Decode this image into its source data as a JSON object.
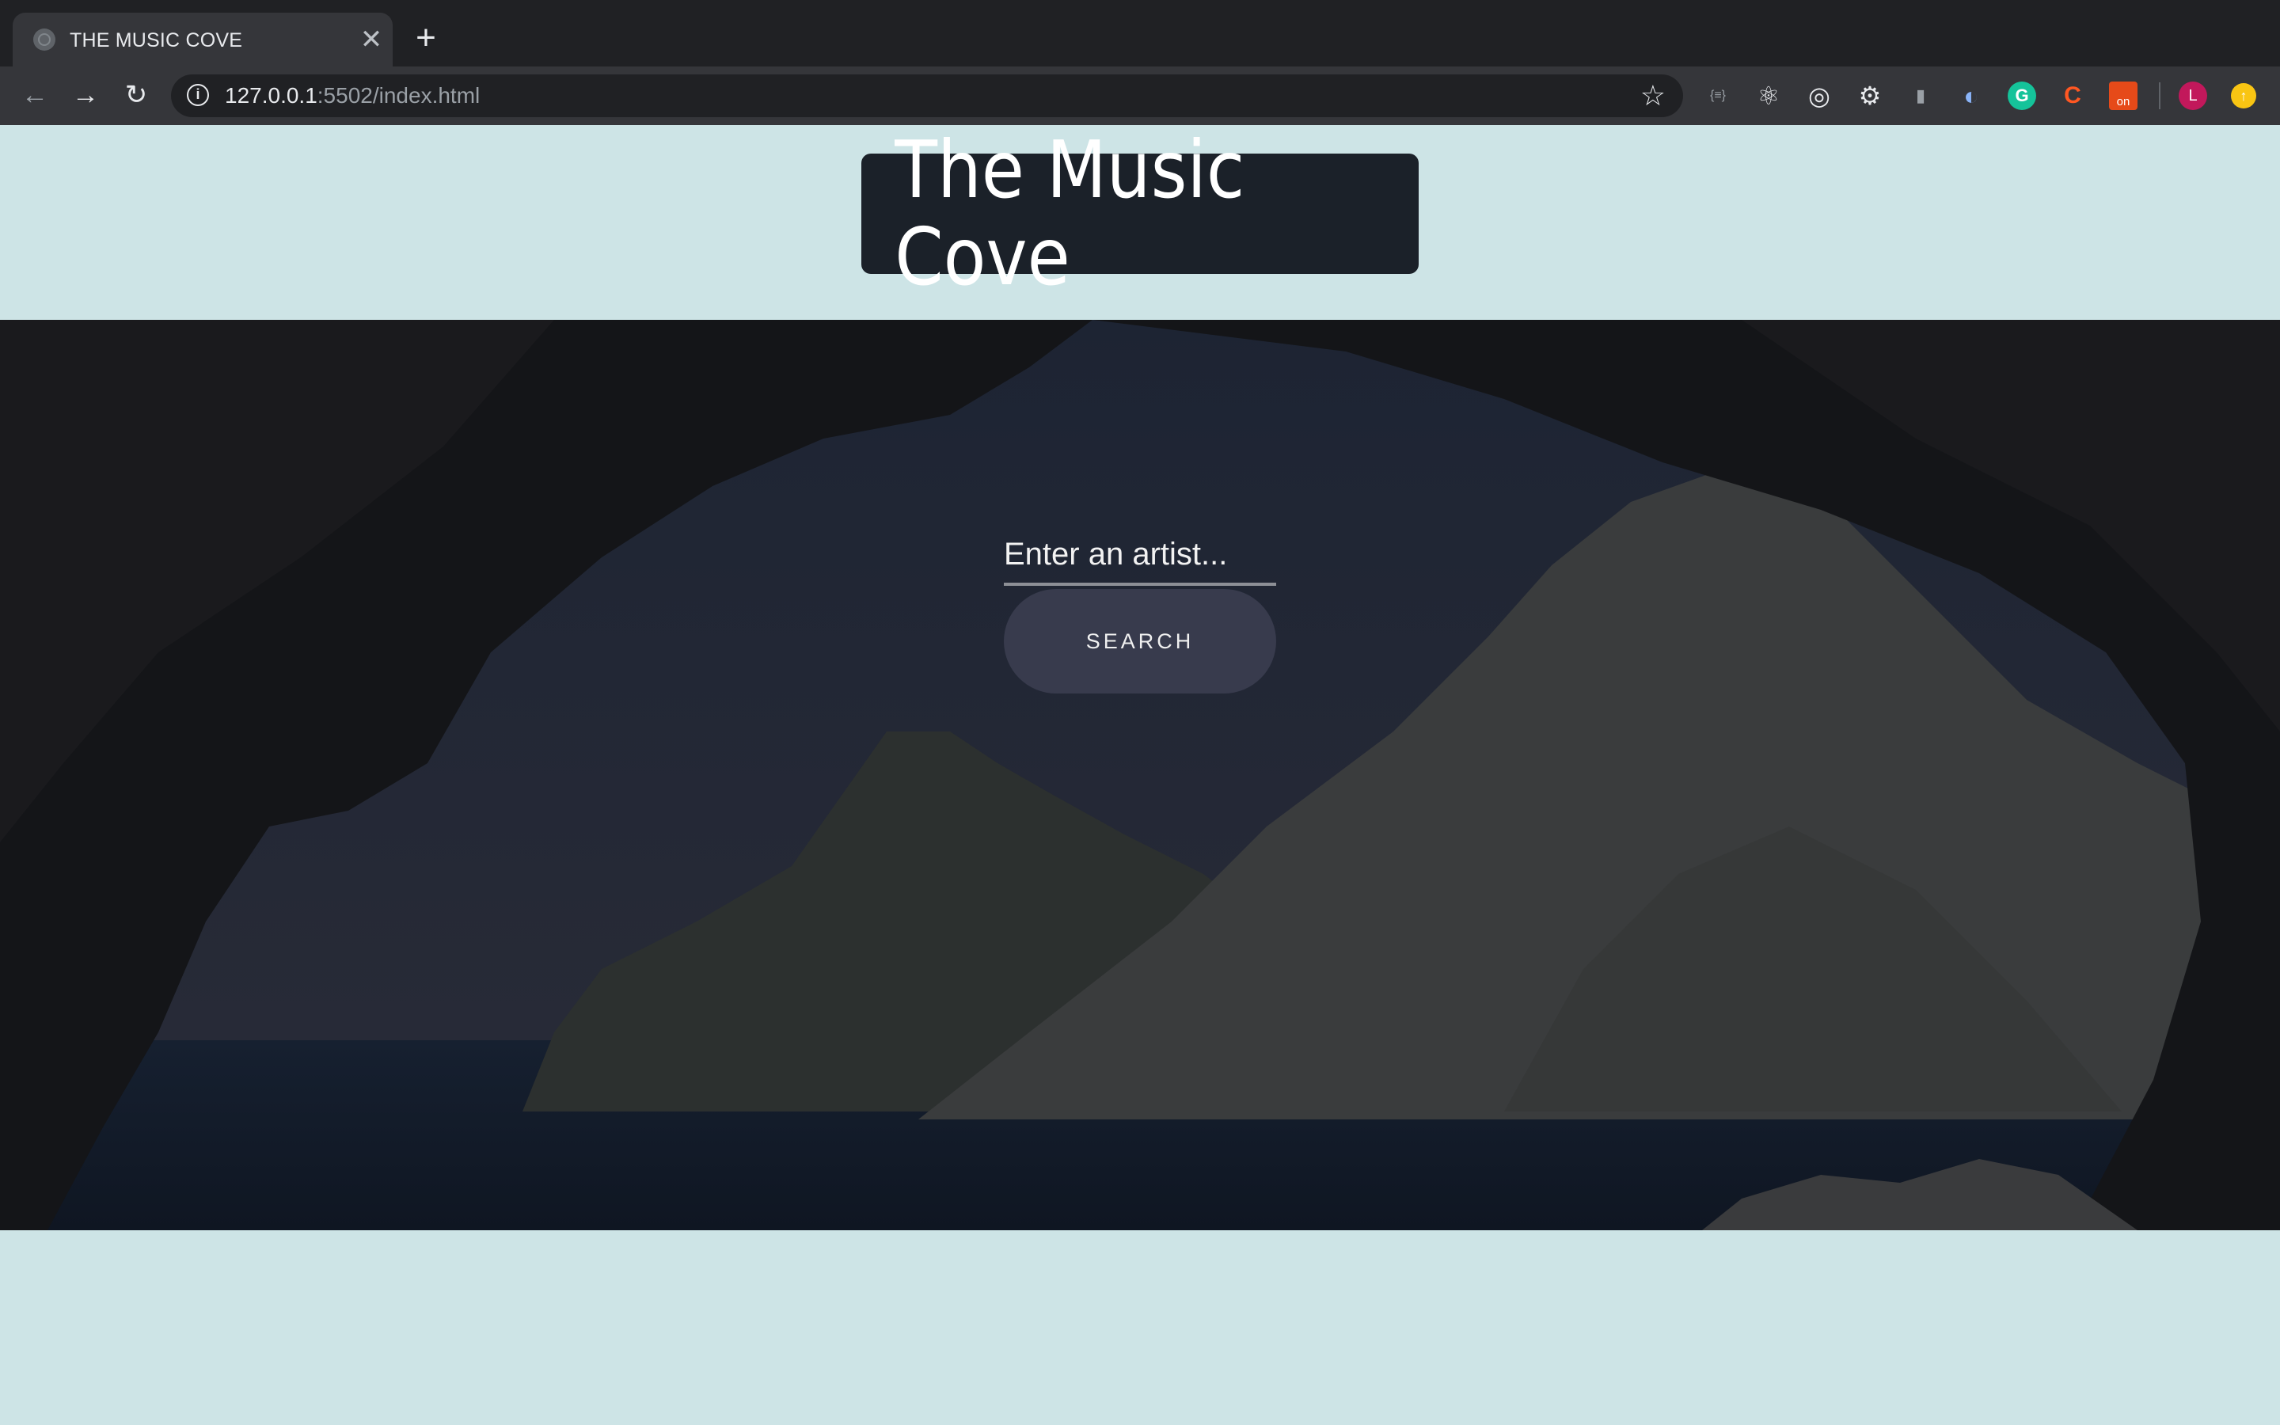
{
  "browser": {
    "tab_title": "THE MUSIC COVE",
    "tab_close_glyph": "✕",
    "new_tab_glyph": "+",
    "back_glyph": "←",
    "forward_glyph": "→",
    "reload_glyph": "↻",
    "url_host": "127.0.0.1",
    "url_rest": ":5502/index.html",
    "star_glyph": "☆",
    "extensions": [
      {
        "name": "json-viewer-icon",
        "glyph": "{≡}"
      },
      {
        "name": "react-devtools-icon",
        "glyph": "⚛"
      },
      {
        "name": "target-extension-icon",
        "glyph": "◎"
      },
      {
        "name": "gear-extension-icon",
        "glyph": "⚙"
      },
      {
        "name": "bottle-extension-icon",
        "glyph": "▮"
      },
      {
        "name": "o-extension-icon",
        "glyph": "◐"
      },
      {
        "name": "grammarly-icon",
        "glyph": "G"
      },
      {
        "name": "c-extension-icon",
        "glyph": "C"
      },
      {
        "name": "on-badge-extension-icon",
        "glyph": "on"
      }
    ],
    "profile_initial": "L",
    "colors": {
      "profile": "#c2185b",
      "grammarly": "#15c39a",
      "update": "#f9c513"
    }
  },
  "page": {
    "title": "The Music Cove",
    "search": {
      "placeholder": "Enter an artist...",
      "value": "",
      "button_label": "SEARCH"
    }
  },
  "colors": {
    "page_bg": "#cde4e6",
    "title_bg": "#1b2129",
    "button_bg": "#383b4d"
  }
}
